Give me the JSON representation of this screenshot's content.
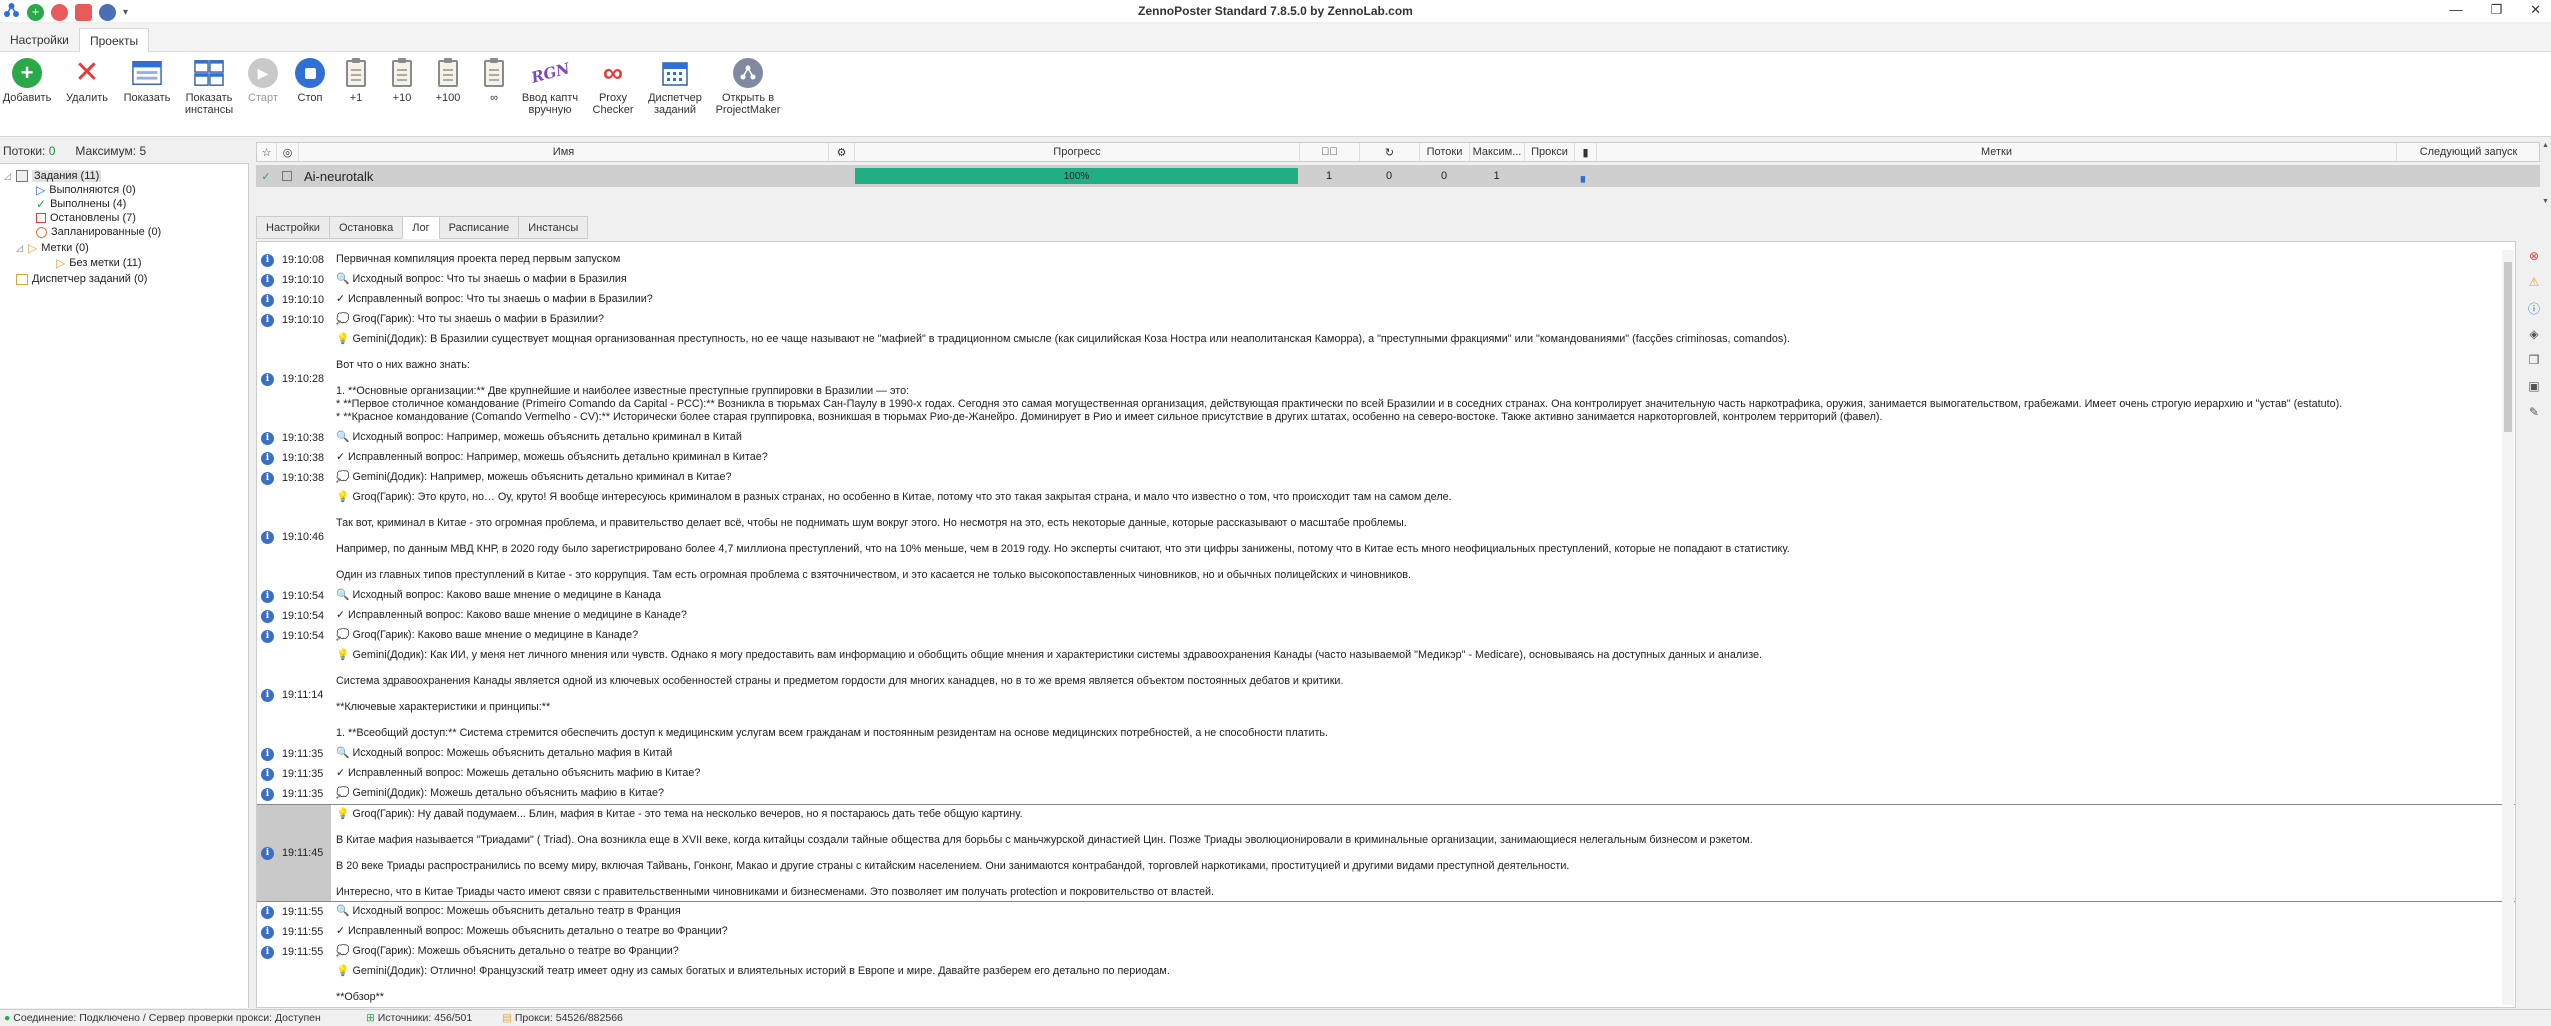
{
  "window": {
    "title": "ZennoPoster Standard 7.8.5.0 by ZennoLab.com"
  },
  "menu": {
    "tabs": [
      "Настройки",
      "Проекты"
    ],
    "active": 1
  },
  "ribbon": {
    "add": "Добавить",
    "delete": "Удалить",
    "show": "Показать",
    "show_instances_1": "Показать",
    "show_instances_2": "инстансы",
    "start": "Старт",
    "stop": "Стоп",
    "plus1": "+1",
    "plus10": "+10",
    "plus100": "+100",
    "infinite": "∞",
    "captcha_1": "Ввод каптч",
    "captcha_2": "вручную",
    "proxy_1": "Proxy",
    "proxy_2": "Checker",
    "tasks_1": "Диспетчер",
    "tasks_2": "заданий",
    "pm_1": "Открыть в",
    "pm_2": "ProjectMaker"
  },
  "threads": {
    "label": "Потоки:",
    "value": "0",
    "max_label": "Максимум:",
    "max_value": "5"
  },
  "tree": {
    "tasks": "Задания (11)",
    "running": "Выполняются (0)",
    "done": "Выполнены (4)",
    "stopped": "Остановлены (7)",
    "scheduled": "Запланированные (0)",
    "tags": "Метки (0)",
    "no_tags": "Без метки (11)",
    "dispatcher": "Диспетчер заданий (0)"
  },
  "grid": {
    "headers": {
      "name": "Имя",
      "progress": "Прогресс",
      "threads": "Потоки",
      "max": "Максим...",
      "proxy": "Прокси",
      "tags": "Метки",
      "next": "Следующий запуск"
    },
    "row": {
      "name": "Ai-neurotalk",
      "progress_text": "100%",
      "progress": 1.0,
      "success": "1",
      "repeats": "0",
      "threads": "0",
      "max": "1"
    }
  },
  "tabs": [
    "Настройки",
    "Остановка",
    "Лог",
    "Расписание",
    "Инстансы"
  ],
  "active_tab": 2,
  "log": [
    {
      "time": "19:10:08",
      "lines": [
        "Первичная компиляция проекта перед первым запуском"
      ]
    },
    {
      "time": "19:10:10",
      "lines": [
        "🔍 Исходный вопрос: Что ты знаешь о мафии в Бразилия"
      ]
    },
    {
      "time": "19:10:10",
      "lines": [
        "✓ Исправленный вопрос: Что ты знаешь о мафии в Бразилии?"
      ]
    },
    {
      "time": "19:10:10",
      "lines": [
        "💭 Groq(Гарик): Что ты знаешь о мафии в Бразилии?"
      ]
    },
    {
      "time": "19:10:28",
      "lines": [
        "💡 Gemini(Додик): В Бразилии существует мощная организованная преступность, но ее чаще называют не \"мафией\" в традиционном смысле (как сицилийская Коза Ностра или неаполитанская Каморра), а \"преступными фракциями\" или \"командованиями\" (facções criminosas, comandos).",
        "",
        "Вот что о них важно знать:",
        "",
        "1.  **Основные организации:** Две крупнейшие и наиболее известные преступные группировки в Бразилии — это:",
        "    *   **Первое столичное командование (Primeiro Comando da Capital - PCC):** Возникла в тюрьмах Сан-Паулу в 1990-х годах. Сегодня это самая могущественная организация, действующая практически по всей Бразилии и в соседних странах. Она контролирует значительную часть наркотрафика, оружия, занимается вымогательством, грабежами. Имеет очень строгую иерархию и \"устав\" (estatuto).",
        "    *   **Красное командование (Comando Vermelho - CV):** Исторически более старая группировка, возникшая в тюрьмах Рио-де-Жанейро. Доминирует в Рио и имеет сильное присутствие в других штатах, особенно на северо-востоке. Также активно занимается наркоторговлей, контролем территорий (фавел)."
      ]
    },
    {
      "time": "19:10:38",
      "lines": [
        "🔍 Исходный вопрос: Например, можешь объяснить детально криминал в Китай"
      ]
    },
    {
      "time": "19:10:38",
      "lines": [
        "✓ Исправленный вопрос: Например, можешь объяснить детально криминал в Китае?"
      ]
    },
    {
      "time": "19:10:38",
      "lines": [
        "💭 Gemini(Додик): Например, можешь объяснить детально криминал в Китае?"
      ]
    },
    {
      "time": "19:10:46",
      "lines": [
        "💡 Groq(Гарик): Это круто, но… Оу, круто! Я вообще интересуюсь криминалом в разных странах, но особенно в Китае, потому что это такая закрытая страна, и мало что известно о том, что происходит там на самом деле.",
        "",
        "Так вот, криминал в Китае - это огромная проблема, и правительство делает всё, чтобы не поднимать шум вокруг этого. Но несмотря на это, есть некоторые данные, которые рассказывают о масштабе проблемы.",
        "",
        "Например, по данным МВД КНР, в 2020 году было зарегистрировано более 4,7 миллиона преступлений, что на 10% меньше, чем в 2019 году. Но эксперты считают, что эти цифры занижены, потому что в Китае есть много неофициальных преступлений, которые не попадают в статистику.",
        "",
        "Один из главных типов преступлений в Китае - это коррупция. Там есть огромная проблема с взяточничеством, и это касается не только высокопоставленных чиновников, но и обычных полицейских и чиновников."
      ]
    },
    {
      "time": "19:10:54",
      "lines": [
        "🔍 Исходный вопрос: Каково ваше мнение о медицине в Канада"
      ]
    },
    {
      "time": "19:10:54",
      "lines": [
        "✓ Исправленный вопрос: Каково ваше мнение о медицине в Канаде?"
      ]
    },
    {
      "time": "19:10:54",
      "lines": [
        "💭 Groq(Гарик): Каково ваше мнение о медицине в Канаде?"
      ]
    },
    {
      "time": "19:11:14",
      "lines": [
        "💡 Gemini(Додик): Как ИИ, у меня нет личного мнения или чувств. Однако я могу предоставить вам информацию и обобщить общие мнения и характеристики системы здравоохранения Канады (часто называемой \"Медикэр\" - Medicare), основываясь на доступных данных и анализе.",
        "",
        "Система здравоохранения Канады является одной из ключевых особенностей страны и предметом гордости для многих канадцев, но в то же время является объектом постоянных дебатов и критики.",
        "",
        "**Ключевые характеристики и принципы:**",
        "",
        "1.  **Всеобщий доступ:** Система стремится обеспечить доступ к медицинским услугам всем гражданам и постоянным резидентам на основе медицинских потребностей, а не способности платить."
      ]
    },
    {
      "time": "19:11:35",
      "lines": [
        "🔍 Исходный вопрос: Можешь объяснить детально мафия в Китай"
      ]
    },
    {
      "time": "19:11:35",
      "lines": [
        "✓ Исправленный вопрос: Можешь детально объяснить мафию в Китае?"
      ]
    },
    {
      "time": "19:11:35",
      "lines": [
        "💭 Gemini(Додик): Можешь детально объяснить мафию в Китае?"
      ]
    },
    {
      "time": "19:11:45",
      "sel": true,
      "lines": [
        "💡 Groq(Гарик): Ну давай подумаем... Блин, мафия в Китае - это тема на несколько вечеров, но я постараюсь дать тебе общую картину.",
        "",
        "В Китае мафия называется \"Триадами\" ( Triad). Она возникла еще в XVII веке, когда китайцы создали тайные общества для борьбы с маньчжурской династией Цин. Позже Триады эволюционировали в криминальные организации, занимающиеся нелегальным бизнесом и рэкетом.",
        "",
        "В 20 веке Триады распространились по всему миру, включая Тайвань, Гонконг, Макао и другие страны с китайским населением. Они занимаются контрабандой, торговлей наркотиками, проституцией и другими видами преступной деятельности.",
        "",
        "Интересно, что в Китае Триады часто имеют связи с правительственными чиновниками и бизнесменами. Это позволяет им получать protection и покровительство от властей."
      ]
    },
    {
      "time": "19:11:55",
      "lines": [
        "🔍 Исходный вопрос: Можешь объяснить детально театр в Франция"
      ]
    },
    {
      "time": "19:11:55",
      "lines": [
        "✓ Исправленный вопрос: Можешь объяснить детально о театре во Франции?"
      ]
    },
    {
      "time": "19:11:55",
      "lines": [
        "💭 Groq(Гарик): Можешь объяснить детально о театре во Франции?"
      ]
    },
    {
      "time": "",
      "lines": [
        "💡 Gemini(Додик): Отлично! Французский театр имеет одну из самых богатых и влиятельных историй в Европе и мире. Давайте разберем его детально по периодам.",
        "",
        "**Обзор**"
      ]
    }
  ],
  "status": {
    "connection": "Соединение: Подключено / Сервер проверки прокси: Доступен",
    "sources": "Источники: 456/501",
    "proxy": "Прокси: 54526/882566"
  }
}
